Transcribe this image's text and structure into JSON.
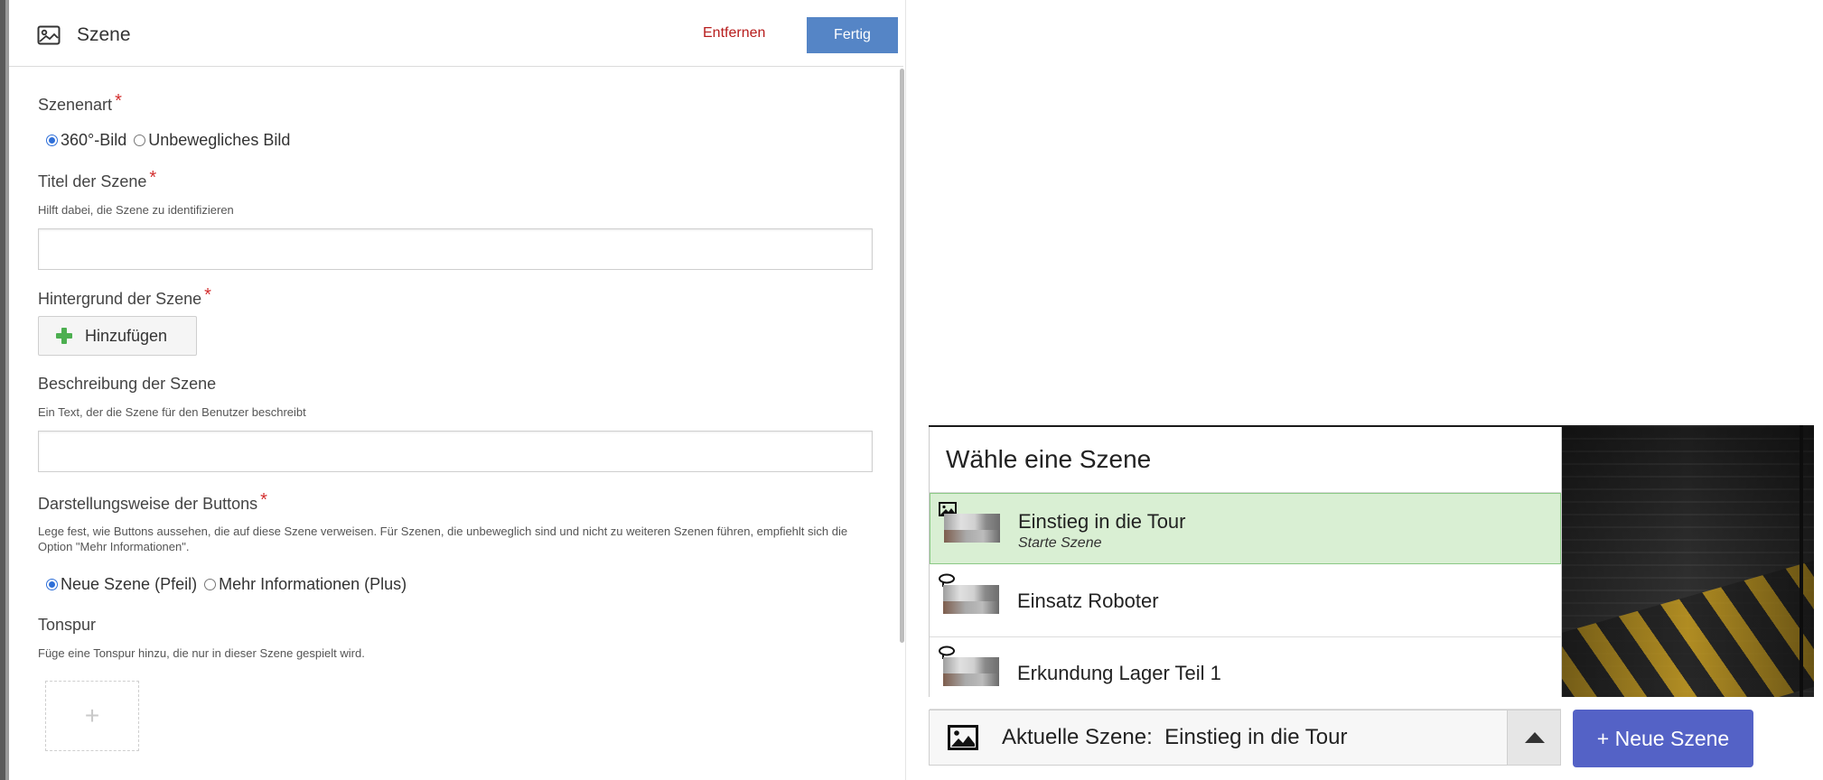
{
  "editor": {
    "title": "Szene",
    "remove_label": "Entfernen",
    "done_label": "Fertig",
    "scene_type": {
      "label": "Szenenart",
      "required_mark": "*",
      "options": [
        "360°-Bild",
        "Unbewegliches Bild"
      ],
      "selected": "360°-Bild"
    },
    "scene_title": {
      "label": "Titel der Szene",
      "required_mark": "*",
      "hint": "Hilft dabei, die Szene zu identifizieren",
      "value": ""
    },
    "background": {
      "label": "Hintergrund der Szene",
      "required_mark": "*",
      "add_label": "Hinzufügen"
    },
    "description": {
      "label": "Beschreibung der Szene",
      "hint": "Ein Text, der die Szene für den Benutzer beschreibt",
      "value": ""
    },
    "button_style": {
      "label": "Darstellungsweise der Buttons",
      "required_mark": "*",
      "hint": "Lege fest, wie Buttons aussehen, die auf diese Szene verweisen. Für Szenen, die unbeweglich sind und nicht zu weiteren Szenen führen, empfiehlt sich die Option \"Mehr Informationen\".",
      "options": [
        "Neue Szene (Pfeil)",
        "Mehr Informationen (Plus)"
      ],
      "selected": "Neue Szene (Pfeil)"
    },
    "audio": {
      "label": "Tonspur",
      "hint": "Füge eine Tonspur hinzu, die nur in dieser Szene gespielt wird.",
      "add_symbol": "+"
    }
  },
  "scene_selector": {
    "title": "Wähle eine Szene",
    "scenes": [
      {
        "name": "Einstieg in die Tour",
        "subtitle": "Starte Szene",
        "type_icon": "image-icon",
        "active": true
      },
      {
        "name": "Einsatz Roboter",
        "subtitle": "",
        "type_icon": "360-icon",
        "active": false
      },
      {
        "name": "Erkundung Lager Teil 1",
        "subtitle": "",
        "type_icon": "360-icon",
        "active": false
      }
    ],
    "current_label": "Aktuelle Szene:",
    "current_value": "Einstieg in die Tour",
    "new_scene_label": "+ Neue Szene"
  },
  "colors": {
    "accent_blue": "#5585c6",
    "danger_red": "#b71c1c",
    "active_green_bg": "#d9efd3",
    "new_scene_purple": "#5462c6"
  }
}
